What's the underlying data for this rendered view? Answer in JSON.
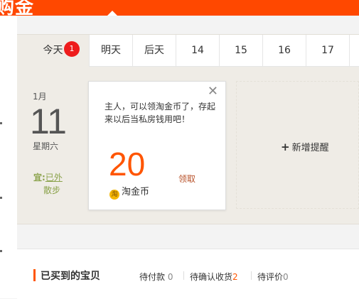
{
  "header": {
    "title": "购金"
  },
  "tabs": [
    {
      "label": "今天",
      "badge": "1"
    },
    {
      "label": "明天"
    },
    {
      "label": "后天"
    },
    {
      "label": "14"
    },
    {
      "label": "15"
    },
    {
      "label": "16"
    },
    {
      "label": "17"
    }
  ],
  "date": {
    "month": "1月",
    "day": "11",
    "weekday": "星期六"
  },
  "advice": {
    "prefix": "宜:",
    "action1": "已外",
    "action2": "散步"
  },
  "card": {
    "message": "主人，可以领淘金币了，存起来以后当私房钱用吧！",
    "amount": "20",
    "claim_label": "领取",
    "coin_icon": "淘",
    "coin_label": "淘金币",
    "close_label": "✕"
  },
  "add_reminder": {
    "plus": "+",
    "label": "新增提醒"
  },
  "orders": {
    "title": "已买到的宝贝",
    "links": [
      {
        "label": "待付款",
        "count": "0"
      },
      {
        "label": "待确认收货",
        "count": "2"
      },
      {
        "label": "待评价",
        "count": "0"
      }
    ]
  },
  "colors": {
    "brand": "#ff4800",
    "accent": "#ff5500",
    "badge": "#ee1c1c",
    "advice": "#8aa24a"
  }
}
